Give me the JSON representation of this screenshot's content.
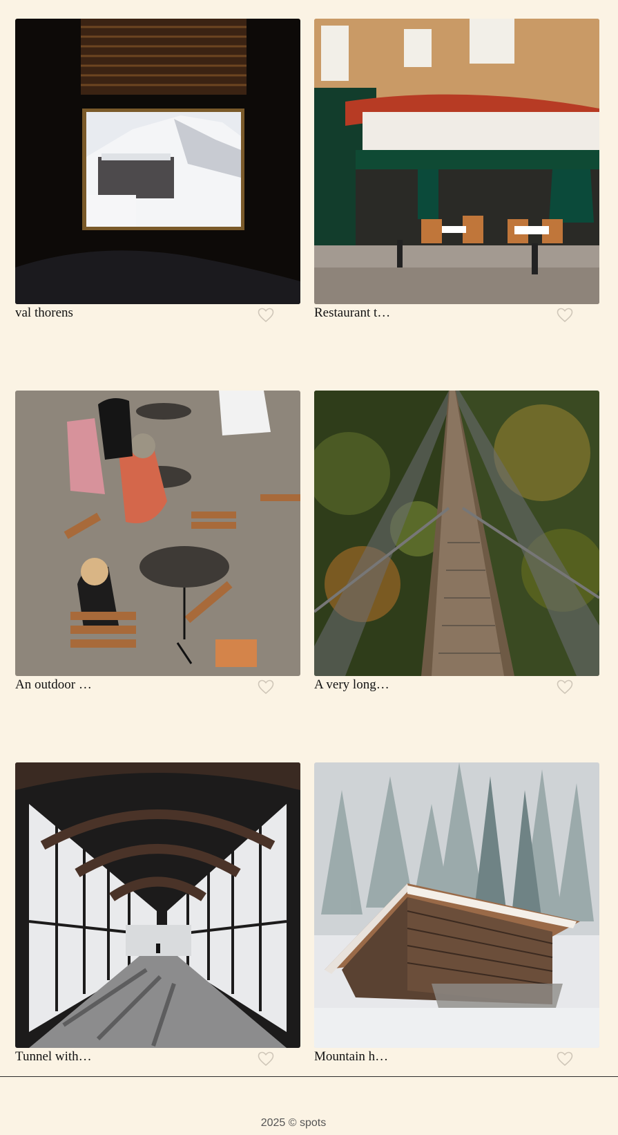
{
  "cards": [
    {
      "title": "val thorens",
      "photo": "snowy-resort-through-window"
    },
    {
      "title": "Restaurant t…",
      "photo": "paris-restaurant-facade"
    },
    {
      "title": "An outdoor …",
      "photo": "outdoor-cafe-terrace"
    },
    {
      "title": "A very long…",
      "photo": "suspension-bridge-forest"
    },
    {
      "title": "Tunnel with…",
      "photo": "glass-covered-walkway"
    },
    {
      "title": "Mountain h…",
      "photo": "wooden-hut-in-snow"
    }
  ],
  "like_icon": "heart-outline-icon",
  "footer": {
    "text": "2025 © spots"
  }
}
